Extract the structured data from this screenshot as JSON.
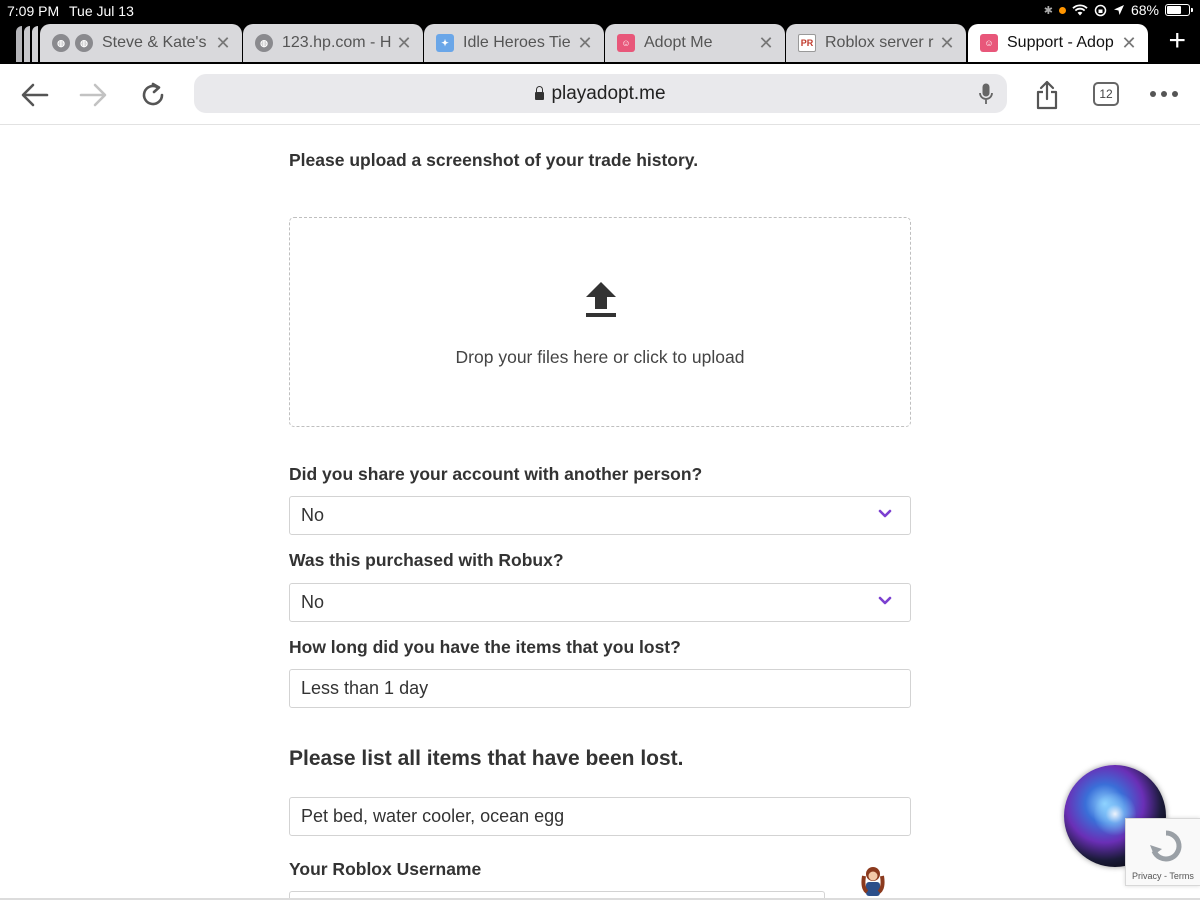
{
  "status_bar": {
    "time": "7:09 PM",
    "date": "Tue Jul 13",
    "battery": "68%",
    "battery_level": 0.68
  },
  "tabs": [
    {
      "label": "Steve & Kate's",
      "favicon": "globe-icon"
    },
    {
      "label": "123.hp.com - H",
      "favicon": "globe-icon"
    },
    {
      "label": "Idle Heroes Tie",
      "favicon": "idle-heroes-favicon"
    },
    {
      "label": "Adopt Me",
      "favicon": "adopt-me-favicon"
    },
    {
      "label": "Roblox server r",
      "favicon": "pr-favicon",
      "favicon_text": "PR"
    },
    {
      "label": "Support - Adop",
      "favicon": "adopt-me-favicon",
      "active": true
    }
  ],
  "toolbar": {
    "url": "playadopt.me",
    "tab_count": "12"
  },
  "form": {
    "upload_label": "Please upload a screenshot of your trade history.",
    "dropzone_text": "Drop your files here or click to upload",
    "q_shared": "Did you share your account with another person?",
    "a_shared": "No",
    "q_robux": "Was this purchased with Robux?",
    "a_robux": "No",
    "q_duration": "How long did you have the items that you lost?",
    "a_duration": "Less than 1 day",
    "items_heading": "Please list all items that have been lost.",
    "a_items": "Pet bed, water cooler, ocean egg",
    "q_username": "Your Roblox Username"
  },
  "recaptcha": {
    "terms": "Privacy - Terms"
  },
  "colors": {
    "chevron": "#7b3fd0",
    "text": "#333333",
    "tab_inactive": "#d9d9dc"
  }
}
